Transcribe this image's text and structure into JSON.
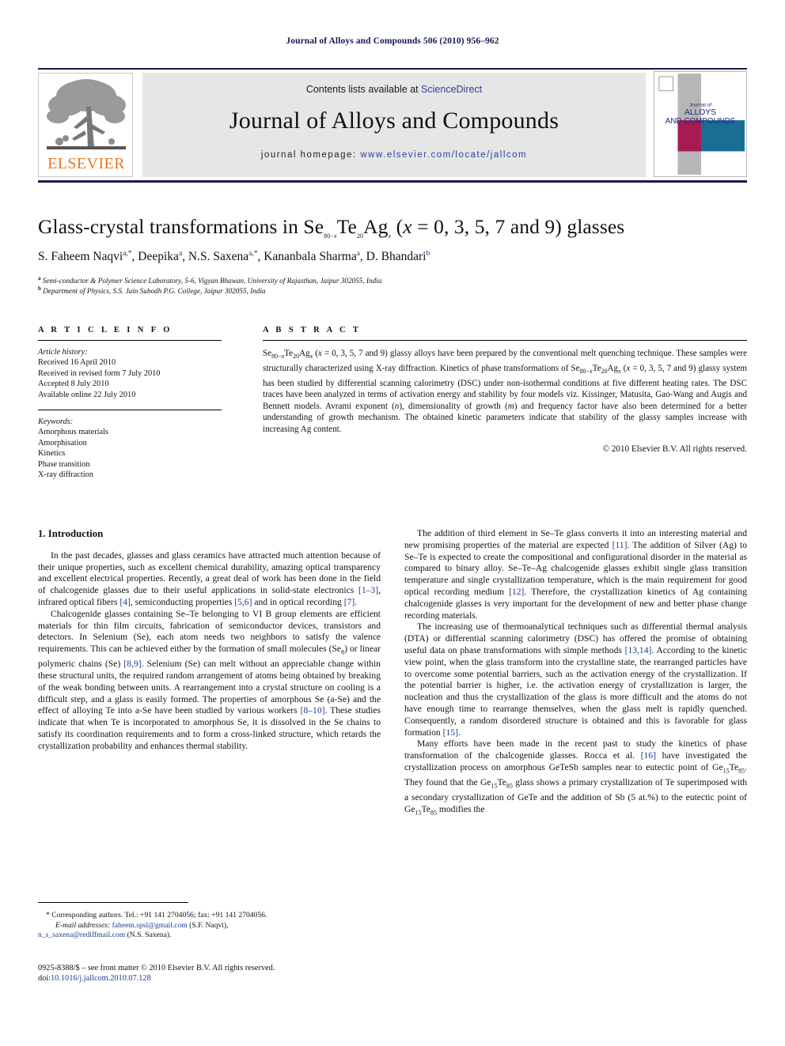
{
  "running_head": "Journal of Alloys and Compounds 506 (2010) 956–962",
  "masthead": {
    "contents_prefix": "Contents lists available at ",
    "sciencedirect": "ScienceDirect",
    "journal_name": "Journal of Alloys and Compounds",
    "homepage_prefix": "journal homepage: ",
    "homepage_url": "www.elsevier.com/locate/jallcom",
    "publisher_wordmark": "ELSEVIER",
    "cover": {
      "line1": "Journal of",
      "line2": "ALLOYS",
      "line3": "AND COMPOUNDS"
    },
    "colors": {
      "link": "#2b3f9e",
      "elsevier_orange": "#e87722",
      "rule_navy": "#1b1b4b",
      "band_grey": "#e6e6e6",
      "cover_crimson": "#a81a52",
      "cover_teal": "#1a6e93",
      "cover_grey": "#b6b6b6"
    }
  },
  "article": {
    "title": "Glass-crystal transformations in Se<sub>80−<i>x</i></sub>Te<sub>20</sub>Ag<sub><i>x</i></sub> (<i>x</i> = 0, 3, 5, 7 and 9) glasses",
    "authors": "S. Faheem Naqvi<sup>a,</sup><sup>*</sup>, Deepika<sup>a</sup>, N.S. Saxena<sup>a,</sup><sup>*</sup>, Kananbala Sharma<sup>a</sup>, D. Bhandari<sup>b</sup>",
    "affiliation_a": "<sup>a</sup> Semi-conductor &amp; Polymer Science Laboratory, 5-6, Vigyan Bhawan, University of Rajasthan, Jaipur 302055, India",
    "affiliation_b": "<sup>b</sup> Department of Physics, S.S. Jain Subodh P.G. College, Jaipur 302055, India"
  },
  "article_info": {
    "heading": "A R T I C L E  I N F O",
    "history_label": "Article history:",
    "history": [
      "Received 16 April 2010",
      "Received in revised form 7 July 2010",
      "Accepted 8 July 2010",
      "Available online 22 July 2010"
    ],
    "keywords_label": "Keywords:",
    "keywords": [
      "Amorphous materials",
      "Amorphisation",
      "Kinetics",
      "Phase transition",
      "X-ray diffraction"
    ]
  },
  "abstract": {
    "heading": "A B S T R A C T",
    "text": "Se<sub>80−<i>x</i></sub>Te<sub>20</sub>Ag<sub><i>x</i></sub> (<i>x</i> = 0, 3, 5, 7 and 9) glassy alloys have been prepared by the conventional melt quenching technique. These samples were structurally characterized using X-ray diffraction. Kinetics of phase transformations of Se<sub>80−<i>x</i></sub>Te<sub>20</sub>Ag<sub><i>x</i></sub> (<i>x</i> = 0, 3, 5, 7 and 9) glassy system has been studied by differential scanning calorimetry (DSC) under non-isothermal conditions at five different heating rates. The DSC traces have been analyzed in terms of activation energy and stability by four models viz. Kissinger, Matusita, Gao-Wang and Augis and Bennett models. Avrami exponent (<i>n</i>), dimensionality of growth (<i>m</i>) and frequency factor have also been determined for a better understanding of growth mechanism. The obtained kinetic parameters indicate that stability of the glassy samples increase with increasing Ag content.",
    "copyright": "© 2010 Elsevier B.V. All rights reserved."
  },
  "body": {
    "section1_heading": "1. Introduction",
    "left_paragraphs": [
      "In the past decades, glasses and glass ceramics have attracted much attention because of their unique properties, such as excellent chemical durability, amazing optical transparency and excellent electrical properties. Recently, a great deal of work has been done in the field of chalcogenide glasses due to their useful applications in solid-state electronics <span class=\"ref\">[1–3]</span>, infrared optical fibers <span class=\"ref\">[4]</span>, semiconducting properties <span class=\"ref\">[5,6]</span> and in optical recording <span class=\"ref\">[7]</span>.",
      "Chalcogenide glasses containing Se–Te belonging to VI B group elements are efficient materials for thin film circuits, fabrication of semiconductor devices, transistors and detectors. In Selenium (Se), each atom needs two neighbors to satisfy the valence requirements. This can be achieved either by the formation of small molecules (Se<sub>8</sub>) or linear polymeric chains (Se) <span class=\"ref\">[8,9]</span>. Selenium (Se) can melt without an appreciable change within these structural units, the required random arrangement of atoms being obtained by breaking of the weak bonding between units. A rearrangement into a crystal structure on cooling is a difficult step, and a glass is easily formed. The properties of amorphous Se (a-Se) and the effect of alloying Te into a-Se have been studied by various workers <span class=\"ref\">[8–10]</span>. These studies indicate that when Te is incorporated to amorphous Se, it is dissolved in the Se chains to satisfy its coordination requirements and to form a cross-linked structure, which retards the crystallization probability and enhances thermal stability."
    ],
    "right_paragraphs": [
      "The addition of third element in Se–Te glass converts it into an interesting material and new promising properties of the material are expected <span class=\"ref\">[11]</span>. The addition of Silver (Ag) to Se–Te is expected to create the compositional and configurational disorder in the material as compared to binary alloy. Se–Te–Ag chalcogenide glasses exhibit single glass transition temperature and single crystallization temperature, which is the main requirement for good optical recording medium <span class=\"ref\">[12]</span>. Therefore, the crystallization kinetics of Ag containing chalcogenide glasses is very important for the development of new and better phase change recording materials.",
      "The increasing use of thermoanalytical techniques such as differential thermal analysis (DTA) or differential scanning calorimetry (DSC) has offered the promise of obtaining useful data on phase transformations with simple methods <span class=\"ref\">[13,14]</span>. According to the kinetic view point, when the glass transform into the crystalline state, the rearranged particles have to overcome some potential barriers, such as the activation energy of the crystallization. If the potential barrier is higher, i.e. the activation energy of crystallization is larger, the nucleation and thus the crystallization of the glass is more difficult and the atoms do not have enough time to rearrange themselves, when the glass melt is rapidly quenched. Consequently, a random disordered structure is obtained and this is favorable for glass formation <span class=\"ref\">[15]</span>.",
      "Many efforts have been made in the recent past to study the kinetics of phase transformation of the chalcogenide glasses. Rocca et al. <span class=\"ref\">[16]</span> have investigated the crystallization process on amorphous GeTeSb samples near to eutectic point of Ge<sub>15</sub>Te<sub>85</sub>. They found that the Ge<sub>15</sub>Te<sub>85</sub> glass shows a primary crystallization of Te superimposed with a secondary crystallization of GeTe and the addition of Sb (5 at.%) to the eutectic point of Ge<sub>15</sub>Te<sub>85</sub> modifies the"
    ]
  },
  "footnotes": {
    "corresponding": "* Corresponding authors. Tel.: +91 141 2704056; fax: +91 141 2704056.",
    "email_label": "E-mail addresses:",
    "email_1": "faheem.spsl@gmail.com",
    "email_1_owner": "(S.F. Naqvi),",
    "email_2": "n_s_saxena@rediffmail.com",
    "email_2_owner": "(N.S. Saxena).",
    "imprint": "0925-8388/$ – see front matter © 2010 Elsevier B.V. All rights reserved.",
    "doi_label": "doi:",
    "doi_value": "10.1016/j.jallcom.2010.07.128"
  }
}
